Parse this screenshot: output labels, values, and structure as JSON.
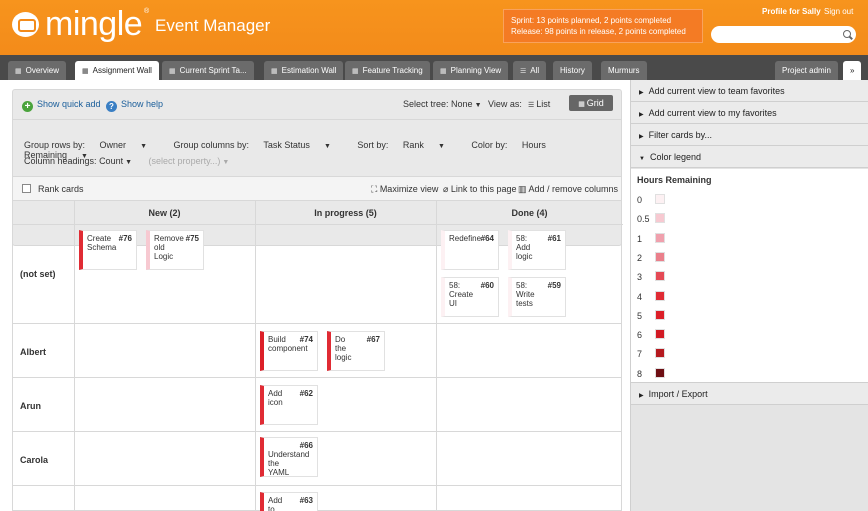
{
  "header": {
    "logo_text": "mingle",
    "logo_tm": "®",
    "app_name": "Event Manager",
    "sprint_line1": "Sprint: 13 points planned, 2 points completed",
    "sprint_line2": "Release: 98 points in release, 2 points completed",
    "profile_link": "Profile for Sally",
    "signout_link": "Sign out",
    "search_placeholder": ""
  },
  "tabs": [
    {
      "label": "Overview",
      "icon": "grid-icon"
    },
    {
      "label": "Assignment Wall",
      "icon": "grid-icon"
    },
    {
      "label": "Current Sprint Ta...",
      "icon": "grid-icon"
    },
    {
      "label": "Estimation Wall",
      "icon": "grid-icon"
    },
    {
      "label": "Feature Tracking",
      "icon": "grid-icon"
    },
    {
      "label": "Planning View",
      "icon": "grid-icon"
    },
    {
      "label": "All",
      "icon": "list-icon"
    },
    {
      "label": "History"
    },
    {
      "label": "Murmurs"
    },
    {
      "label": "Project admin"
    },
    {
      "label": "»"
    }
  ],
  "controls": {
    "quick_add": "Show quick add",
    "help": "Show help",
    "select_tree_label": "Select tree:",
    "select_tree_value": "None",
    "view_as_label": "View as:",
    "list_label": "List",
    "grid_label": "Grid",
    "group_rows_label": "Group rows by:",
    "group_rows_value": "Owner",
    "group_cols_label": "Group columns by:",
    "group_cols_value": "Task Status",
    "sort_label": "Sort by:",
    "sort_value": "Rank",
    "color_label": "Color by:",
    "color_value": "Hours Remaining",
    "col_headings_label": "Column headings:",
    "col_headings_value": "Count",
    "select_property": "(select property...)"
  },
  "grid": {
    "rank_cards": "Rank cards",
    "maximize": "Maximize view",
    "link_page": "Link to this page",
    "add_remove": "Add / remove columns",
    "columns": [
      "New (2)",
      "In progress (5)",
      "Done (4)"
    ],
    "rows": [
      "(not set)",
      "Albert",
      "Arun",
      "Carola"
    ]
  },
  "cards": {
    "c76": {
      "title": "Create Schema",
      "num": "#76"
    },
    "c75": {
      "title": "Remove old Logic",
      "num": "#75"
    },
    "c64": {
      "title": "Redefine",
      "num": "#64"
    },
    "c61": {
      "title": "58: Add logic",
      "num": "#61"
    },
    "c60": {
      "title": "58: Create UI",
      "num": "#60"
    },
    "c59": {
      "title": "58: Write tests",
      "num": "#59"
    },
    "c74": {
      "title": "Build component",
      "num": "#74"
    },
    "c67": {
      "title": "Do the logic",
      "num": "#67"
    },
    "c62": {
      "title": "Add icon",
      "num": "#62"
    },
    "c66": {
      "title": "Understand the YAML",
      "num": "#66"
    },
    "c63": {
      "title": "Add to logic",
      "num": "#63"
    }
  },
  "sidebar": {
    "items": [
      "Add current view to team favorites",
      "Add current view to my favorites",
      "Filter cards by...",
      "Color legend",
      "Import / Export"
    ],
    "legend_title": "Hours Remaining",
    "legend": [
      {
        "value": "0",
        "color": "#fdf1f3"
      },
      {
        "value": "0.5",
        "color": "#f7c9d1"
      },
      {
        "value": "1",
        "color": "#f0a0ad"
      },
      {
        "value": "2",
        "color": "#ea7f8b"
      },
      {
        "value": "3",
        "color": "#e44a55"
      },
      {
        "value": "4",
        "color": "#e02b34"
      },
      {
        "value": "5",
        "color": "#dc1f28"
      },
      {
        "value": "6",
        "color": "#d21a24"
      },
      {
        "value": "7",
        "color": "#b5191f"
      },
      {
        "value": "8",
        "color": "#6e0f13"
      }
    ]
  }
}
